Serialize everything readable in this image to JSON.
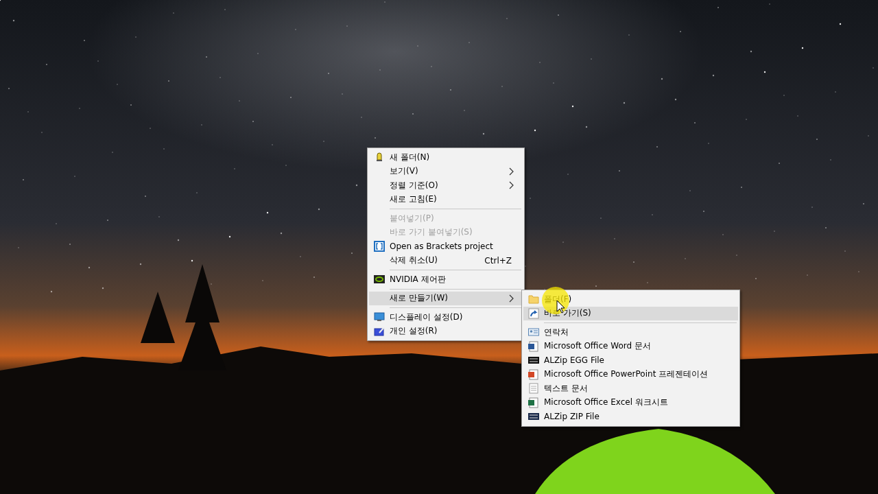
{
  "context_menu": {
    "items": [
      {
        "kind": "item",
        "label": "새 폴더(N)",
        "submenu": false,
        "disabled": false,
        "selected": false
      },
      {
        "kind": "item",
        "label": "보기(V)",
        "submenu": true,
        "disabled": false,
        "selected": false
      },
      {
        "kind": "item",
        "label": "정렬 기준(O)",
        "submenu": true,
        "disabled": false,
        "selected": false
      },
      {
        "kind": "item",
        "label": "새로 고침(E)",
        "submenu": false,
        "disabled": false,
        "selected": false
      },
      {
        "kind": "separator"
      },
      {
        "kind": "item",
        "label": "붙여넣기(P)",
        "submenu": false,
        "disabled": true,
        "selected": false
      },
      {
        "kind": "item",
        "label": "바로 가기 붙여넣기(S)",
        "submenu": false,
        "disabled": true,
        "selected": false
      },
      {
        "kind": "item",
        "label": "Open as Brackets project",
        "submenu": false,
        "disabled": false,
        "selected": false
      },
      {
        "kind": "item",
        "label": "삭제 취소(U)",
        "shortcut": "Ctrl+Z",
        "submenu": false,
        "disabled": false,
        "selected": false
      },
      {
        "kind": "separator"
      },
      {
        "kind": "item",
        "label": "NVIDIA 제어판",
        "submenu": false,
        "disabled": false,
        "selected": false
      },
      {
        "kind": "separator"
      },
      {
        "kind": "item",
        "label": "새로 만들기(W)",
        "submenu": true,
        "disabled": false,
        "selected": true
      },
      {
        "kind": "separator"
      },
      {
        "kind": "item",
        "label": "디스플레이 설정(D)",
        "submenu": false,
        "disabled": false,
        "selected": false
      },
      {
        "kind": "item",
        "label": "개인 설정(R)",
        "submenu": false,
        "disabled": false,
        "selected": false
      }
    ]
  },
  "new_submenu": {
    "items": [
      {
        "kind": "item",
        "label": "폴더(F)",
        "submenu": false,
        "disabled": false,
        "selected": false
      },
      {
        "kind": "item",
        "label": "바로 가기(S)",
        "submenu": false,
        "disabled": false,
        "selected": true
      },
      {
        "kind": "separator"
      },
      {
        "kind": "item",
        "label": "연락처",
        "submenu": false,
        "disabled": false,
        "selected": false
      },
      {
        "kind": "item",
        "label": "Microsoft Office Word 문서",
        "submenu": false,
        "disabled": false,
        "selected": false
      },
      {
        "kind": "item",
        "label": "ALZip EGG File",
        "submenu": false,
        "disabled": false,
        "selected": false
      },
      {
        "kind": "item",
        "label": "Microsoft Office PowerPoint 프레젠테이션",
        "submenu": false,
        "disabled": false,
        "selected": false
      },
      {
        "kind": "item",
        "label": "텍스트 문서",
        "submenu": false,
        "disabled": false,
        "selected": false
      },
      {
        "kind": "item",
        "label": "Microsoft Office Excel 워크시트",
        "submenu": false,
        "disabled": false,
        "selected": false
      },
      {
        "kind": "item",
        "label": "ALZip ZIP File",
        "submenu": false,
        "disabled": false,
        "selected": false
      }
    ]
  }
}
